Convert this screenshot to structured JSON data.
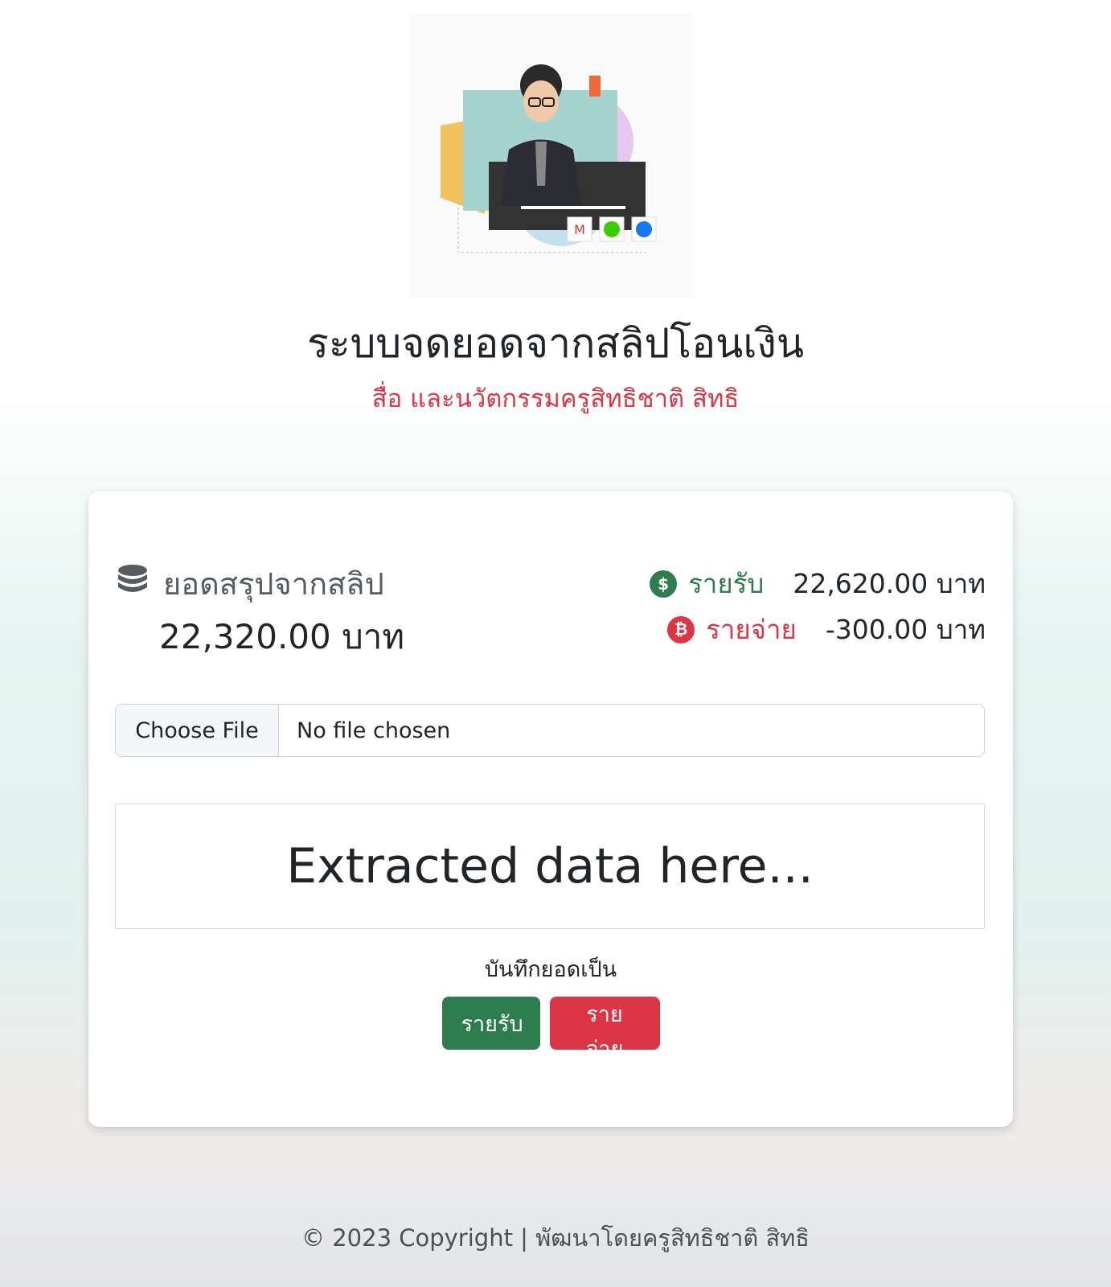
{
  "header": {
    "title": "ระบบจดยอดจากสลิปโอนเงิน",
    "subtitle": "สื่อ และนวัตกรรมครูสิทธิชาติ สิทธิ"
  },
  "summary": {
    "label": "ยอดสรุปจากสลิป",
    "value": "22,320.00 บาท",
    "icon": "coins-icon"
  },
  "income": {
    "label": "รายรับ",
    "value": "22,620.00 บาท",
    "icon": "money-hand-icon",
    "color": "#2e7d4f"
  },
  "expense": {
    "label": "รายจ่าย",
    "value": "-300.00 บาท",
    "icon": "bitcoin-icon",
    "color": "#dc3545"
  },
  "file_input": {
    "button_label": "Choose File",
    "status_text": "No file chosen"
  },
  "extracted": {
    "text": "Extracted data here..."
  },
  "save": {
    "label": "บันทึกยอดเป็น",
    "income_button": "รายรับ",
    "expense_button": "รายจ่าย"
  },
  "footer": {
    "text": "© 2023 Copyright | พัฒนาโดยครูสิทธิชาติ สิทธิ"
  }
}
